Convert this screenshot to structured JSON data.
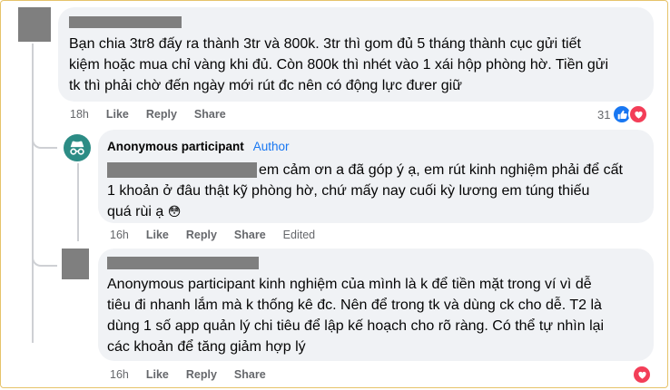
{
  "comments": [
    {
      "text": "Bạn chia 3tr8 đấy ra thành 3tr và 800k. 3tr thì gom đủ 5 tháng thành cục gửi tiết kiệm hoặc mua chỉ vàng khi đủ. Còn 800k thì nhét vào 1 xái hộp phòng hờ. Tiền gửi tk thì phải chờ đến ngày mới rút đc nên có động lực đưer giữ",
      "line1": "Bạn chia 3tr8 đấy ra thành 3tr và 800k. 3tr thì gom đủ 5 tháng thành cục gửi tiết",
      "line2": "kiệm hoặc mua chỉ vàng khi đủ. Còn 800k thì nhét vào 1 xái hộp phòng hờ. Tiền gửi",
      "line3": "tk thì phải chờ đến ngày mới rút đc nên có động lực đưer giữ",
      "time": "18h",
      "like": "Like",
      "reply": "Reply",
      "share": "Share",
      "reaction_count": "31",
      "reactions": [
        "like-icon",
        "love-icon"
      ]
    },
    {
      "name": "Anonymous participant",
      "badge": "Author",
      "line1": "em cảm ơn a đã góp ý ạ, em rút kinh nghiệm phải để cất",
      "line2": "1 khoản ở đâu thật kỹ phòng hờ, chứ mấy nay cuối kỳ lương em túng thiếu",
      "line3": "quá rùi ạ",
      "emoji": "😳",
      "time": "16h",
      "like": "Like",
      "reply": "Reply",
      "share": "Share",
      "edited": "Edited"
    },
    {
      "line1": "Anonymous participant kinh nghiệm của mình là k để tiền mặt trong ví vì dễ",
      "line2": "tiêu đi nhanh lắm mà k thống kê đc. Nên để trong tk và dùng ck cho dễ. T2 là",
      "line3": "dùng 1 số app quản lý chi tiêu để lập kế hoạch cho rõ ràng. Có thể tự nhìn lại",
      "line4": "các khoản để tăng giảm hợp lý",
      "time": "16h",
      "like": "Like",
      "reply": "Reply",
      "share": "Share",
      "reactions": [
        "love-icon"
      ]
    }
  ],
  "colors": {
    "bubble": "#f0f2f5",
    "meta": "#65676b",
    "author": "#1877f2",
    "like": "#1877f2",
    "love": "#f33e58",
    "redaction": "#7f7f7f",
    "frame": "#e6c36a"
  }
}
